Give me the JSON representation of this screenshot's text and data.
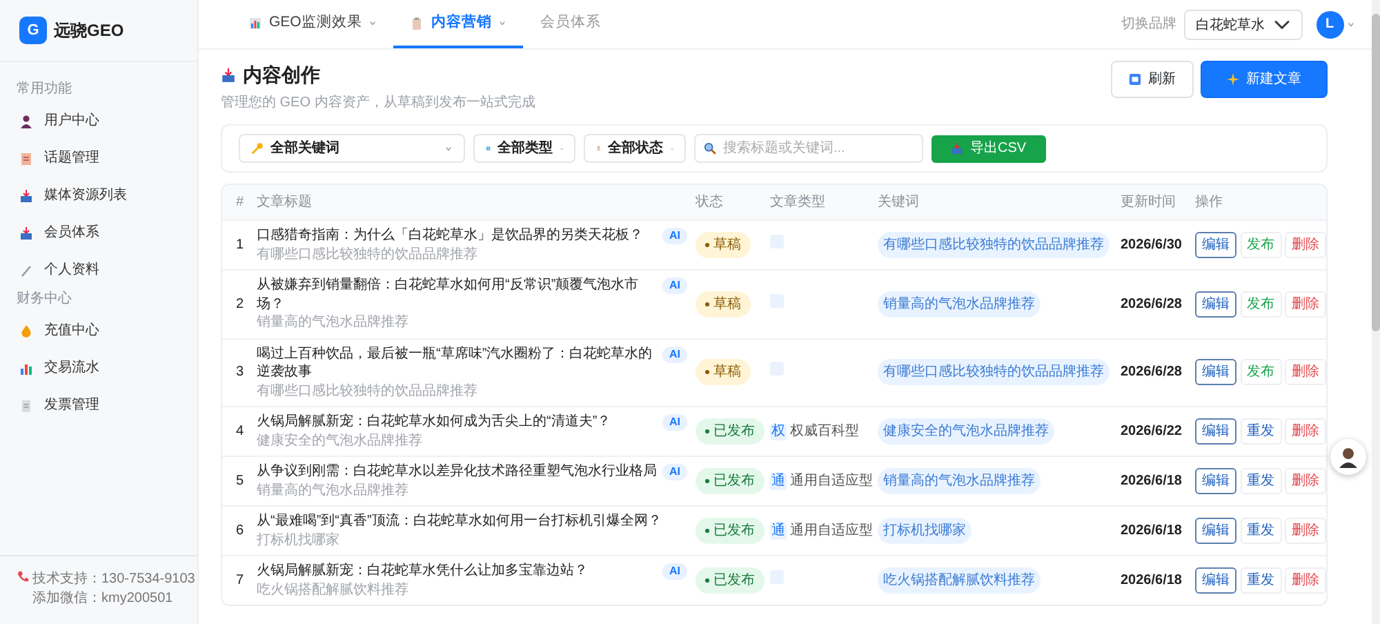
{
  "brand": {
    "logo_letter": "G",
    "name": "远骁GEO"
  },
  "sidebar": {
    "sections": [
      {
        "title": "常用功能",
        "items": [
          {
            "label": "用户中心"
          },
          {
            "label": "话题管理"
          },
          {
            "label": "媒体资源列表"
          },
          {
            "label": "会员体系"
          },
          {
            "label": "个人资料"
          }
        ]
      },
      {
        "title": "财务中心",
        "items": [
          {
            "label": "充值中心"
          },
          {
            "label": "交易流水"
          },
          {
            "label": "发票管理"
          }
        ]
      }
    ],
    "footer": {
      "support": "技术支持：130-7534-9103",
      "wechat": "添加微信：kmy200501"
    }
  },
  "topnav": {
    "tabs": [
      {
        "label": "GEO监测效果",
        "dropdown": true,
        "selected": false
      },
      {
        "label": "内容营销",
        "dropdown": true,
        "selected": true
      },
      {
        "label": "会员体系",
        "dropdown": false,
        "selected": false
      }
    ],
    "brand_switch": {
      "label": "切换品牌",
      "value": "白花蛇草水"
    },
    "avatar": "L"
  },
  "page": {
    "title": "内容创作",
    "subtitle": "管理您的 GEO 内容资产，从草稿到发布一站式完成",
    "buttons": [
      {
        "label": "刷新",
        "kind": "outline"
      },
      {
        "label": "新建文章",
        "kind": "primary"
      }
    ]
  },
  "filters": {
    "selects": [
      {
        "value": "全部关键词"
      },
      {
        "value": "全部类型"
      },
      {
        "value": "全部状态"
      }
    ],
    "search": {
      "placeholder": "搜索标题或关键词..."
    },
    "export": "导出CSV"
  },
  "table": {
    "columns": [
      "#",
      "文章标题",
      "状态",
      "文章类型",
      "关键词",
      "更新时间",
      "操作"
    ],
    "rows": [
      {
        "index": "1",
        "title": "口感猎奇指南：为什么「白花蛇草水」是饮品界的另类天花板？",
        "ai": "AI",
        "subtitle": "有哪些口感比较独特的饮品品牌推荐",
        "status": "草稿",
        "published": false,
        "keyword": "有哪些口感比较独特的饮品品牌推荐",
        "date": "2026/6/30",
        "actions": [
          {
            "label": "编辑",
            "kind": "edit"
          },
          {
            "label": "发布",
            "kind": "publish"
          },
          {
            "label": "删除",
            "kind": "delete"
          }
        ]
      },
      {
        "index": "2",
        "title": "从被嫌弃到销量翻倍：白花蛇草水如何用“反常识”颠覆气泡水市场？",
        "ai": "AI",
        "subtitle": "销量高的气泡水品牌推荐",
        "status": "草稿",
        "published": false,
        "keyword": "销量高的气泡水品牌推荐",
        "date": "2026/6/28",
        "actions": [
          {
            "label": "编辑",
            "kind": "edit"
          },
          {
            "label": "发布",
            "kind": "publish"
          },
          {
            "label": "删除",
            "kind": "delete"
          }
        ]
      },
      {
        "index": "3",
        "title": "喝过上百种饮品，最后被一瓶“草席味”汽水圈粉了：白花蛇草水的逆袭故事",
        "ai": "AI",
        "subtitle": "有哪些口感比较独特的饮品品牌推荐",
        "status": "草稿",
        "published": false,
        "keyword": "有哪些口感比较独特的饮品品牌推荐",
        "date": "2026/6/28",
        "actions": [
          {
            "label": "编辑",
            "kind": "edit"
          },
          {
            "label": "发布",
            "kind": "publish"
          },
          {
            "label": "删除",
            "kind": "delete"
          }
        ]
      },
      {
        "index": "4",
        "title": "火锅局解腻新宠：白花蛇草水如何成为舌尖上的“清道夫”？",
        "ai": "AI",
        "subtitle": "健康安全的气泡水品牌推荐",
        "status": "已发布",
        "published": true,
        "type": {
          "badge": "权",
          "label": "权威百科型"
        },
        "keyword": "健康安全的气泡水品牌推荐",
        "date": "2026/6/22",
        "actions": [
          {
            "label": "编辑",
            "kind": "edit"
          },
          {
            "label": "重发",
            "kind": "republish"
          },
          {
            "label": "删除",
            "kind": "delete"
          }
        ]
      },
      {
        "index": "5",
        "title": "从争议到刚需：白花蛇草水以差异化技术路径重塑气泡水行业格局",
        "ai": "AI",
        "subtitle": "销量高的气泡水品牌推荐",
        "status": "已发布",
        "published": true,
        "type": {
          "badge": "通",
          "label": "通用自适应型"
        },
        "keyword": "销量高的气泡水品牌推荐",
        "date": "2026/6/18",
        "actions": [
          {
            "label": "编辑",
            "kind": "edit"
          },
          {
            "label": "重发",
            "kind": "republish"
          },
          {
            "label": "删除",
            "kind": "delete"
          }
        ]
      },
      {
        "index": "6",
        "title": "从“最难喝”到“真香”顶流：白花蛇草水如何用一台打标机引爆全网？",
        "subtitle": "打标机找哪家",
        "status": "已发布",
        "published": true,
        "type": {
          "badge": "通",
          "label": "通用自适应型"
        },
        "keyword": "打标机找哪家",
        "date": "2026/6/18",
        "actions": [
          {
            "label": "编辑",
            "kind": "edit"
          },
          {
            "label": "重发",
            "kind": "republish"
          },
          {
            "label": "删除",
            "kind": "delete"
          }
        ]
      },
      {
        "index": "7",
        "title": "火锅局解腻新宠：白花蛇草水凭什么让加多宝靠边站？",
        "ai": "AI",
        "subtitle": "吃火锅搭配解腻饮料推荐",
        "status": "已发布",
        "published": true,
        "keyword": "吃火锅搭配解腻饮料推荐",
        "date": "2026/6/18",
        "actions": [
          {
            "label": "编辑",
            "kind": "edit"
          },
          {
            "label": "重发",
            "kind": "republish"
          },
          {
            "label": "删除",
            "kind": "delete"
          }
        ]
      }
    ]
  }
}
